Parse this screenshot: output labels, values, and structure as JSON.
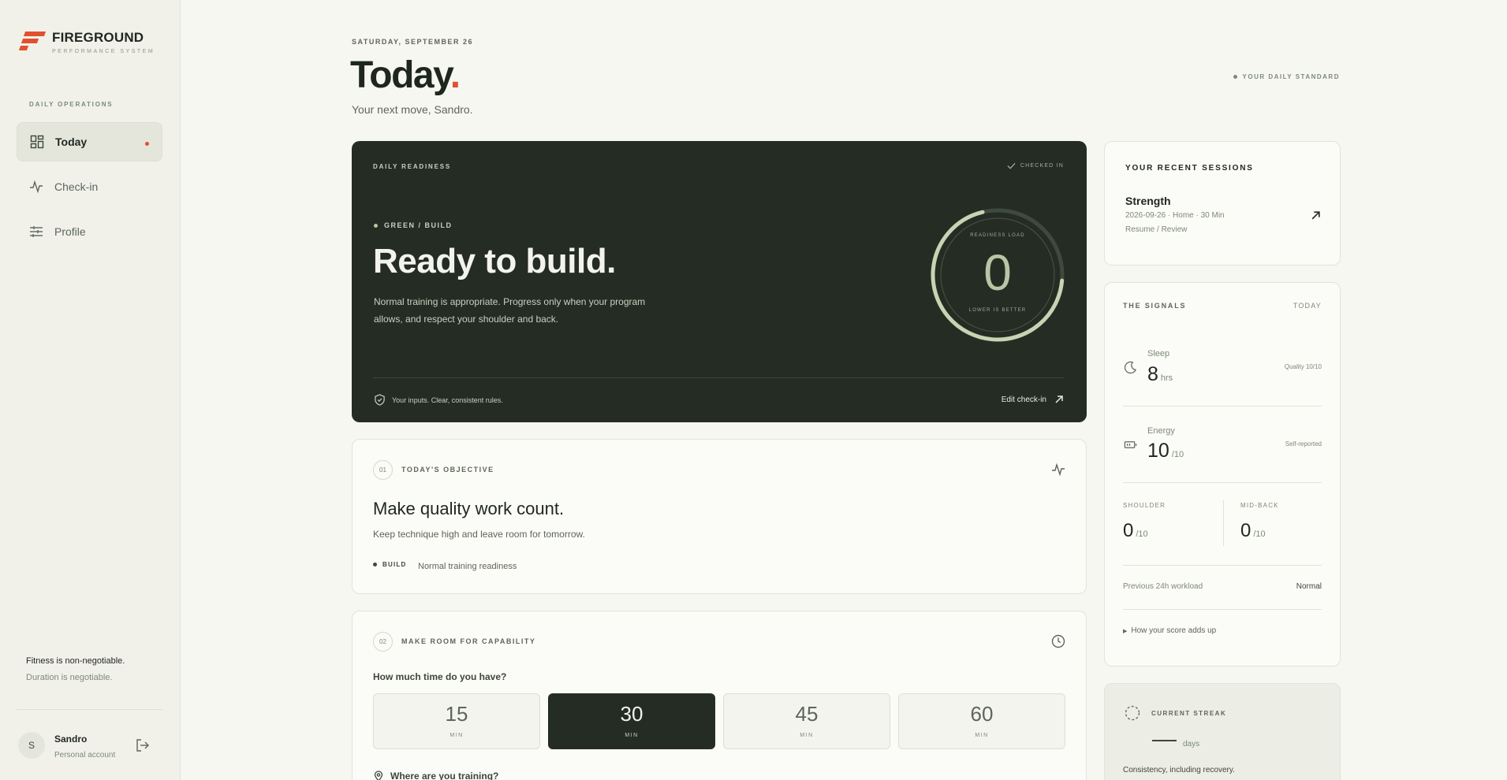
{
  "brand": {
    "name": "FIREGROUND",
    "tagline": "PERFORMANCE SYSTEM",
    "accent": "#e0512f"
  },
  "sidebar": {
    "section": "DAILY OPERATIONS",
    "items": [
      {
        "label": "Today",
        "icon": "grid-icon",
        "active": true
      },
      {
        "label": "Check-in",
        "icon": "pulse-icon",
        "active": false
      },
      {
        "label": "Profile",
        "icon": "sliders-icon",
        "active": false
      }
    ],
    "motto_line1": "Fitness is non-negotiable.",
    "motto_line2": "Duration is negotiable.",
    "user": {
      "initial": "S",
      "name": "Sandro",
      "role": "Personal account"
    }
  },
  "header": {
    "date": "SATURDAY, SEPTEMBER 26",
    "title": "Today",
    "title_dot": ".",
    "subtitle": "Your next move, Sandro.",
    "standard": "YOUR DAILY STANDARD"
  },
  "readiness": {
    "label": "DAILY READINESS",
    "checked": "CHECKED IN",
    "status": "GREEN / BUILD",
    "headline": "Ready to build.",
    "description": "Normal training is appropriate. Progress only when your program allows, and respect your shoulder and back.",
    "ring_top": "READINESS LOAD",
    "ring_value": "0",
    "ring_bottom": "LOWER IS BETTER",
    "footer": "Your inputs. Clear, consistent rules.",
    "edit": "Edit check-in"
  },
  "objective": {
    "num": "01",
    "title": "TODAY'S OBJECTIVE",
    "headline": "Make quality work count.",
    "sub": "Keep technique high and leave room for tomorrow.",
    "tag": "BUILD",
    "tag_text": "Normal training readiness"
  },
  "capability": {
    "num": "02",
    "title": "MAKE ROOM FOR CAPABILITY",
    "question": "How much time do you have?",
    "options": [
      {
        "value": "15",
        "unit": "MIN",
        "selected": false
      },
      {
        "value": "30",
        "unit": "MIN",
        "selected": true
      },
      {
        "value": "45",
        "unit": "MIN",
        "selected": false
      },
      {
        "value": "60",
        "unit": "MIN",
        "selected": false
      }
    ],
    "where": "Where are you training?"
  },
  "sessions": {
    "title": "YOUR RECENT SESSIONS",
    "name": "Strength",
    "meta": "2026-09-26 · Home · 30 Min",
    "link": "Resume / Review"
  },
  "signals": {
    "title": "THE SIGNALS",
    "today": "TODAY",
    "sleep_label": "Sleep",
    "sleep_value": "8",
    "sleep_unit": "hrs",
    "sleep_note": "Quality 10/10",
    "energy_label": "Energy",
    "energy_value": "10",
    "energy_unit": "/10",
    "energy_note": "Self-reported",
    "shoulder_label": "SHOULDER",
    "shoulder_value": "0",
    "shoulder_unit": "/10",
    "midback_label": "MID-BACK",
    "midback_value": "0",
    "midback_unit": "/10",
    "workload_label": "Previous 24h workload",
    "workload_value": "Normal",
    "expand": "How your score adds up"
  },
  "streak": {
    "title": "CURRENT STREAK",
    "days": "days",
    "consistency": "Consistency, including recovery."
  }
}
